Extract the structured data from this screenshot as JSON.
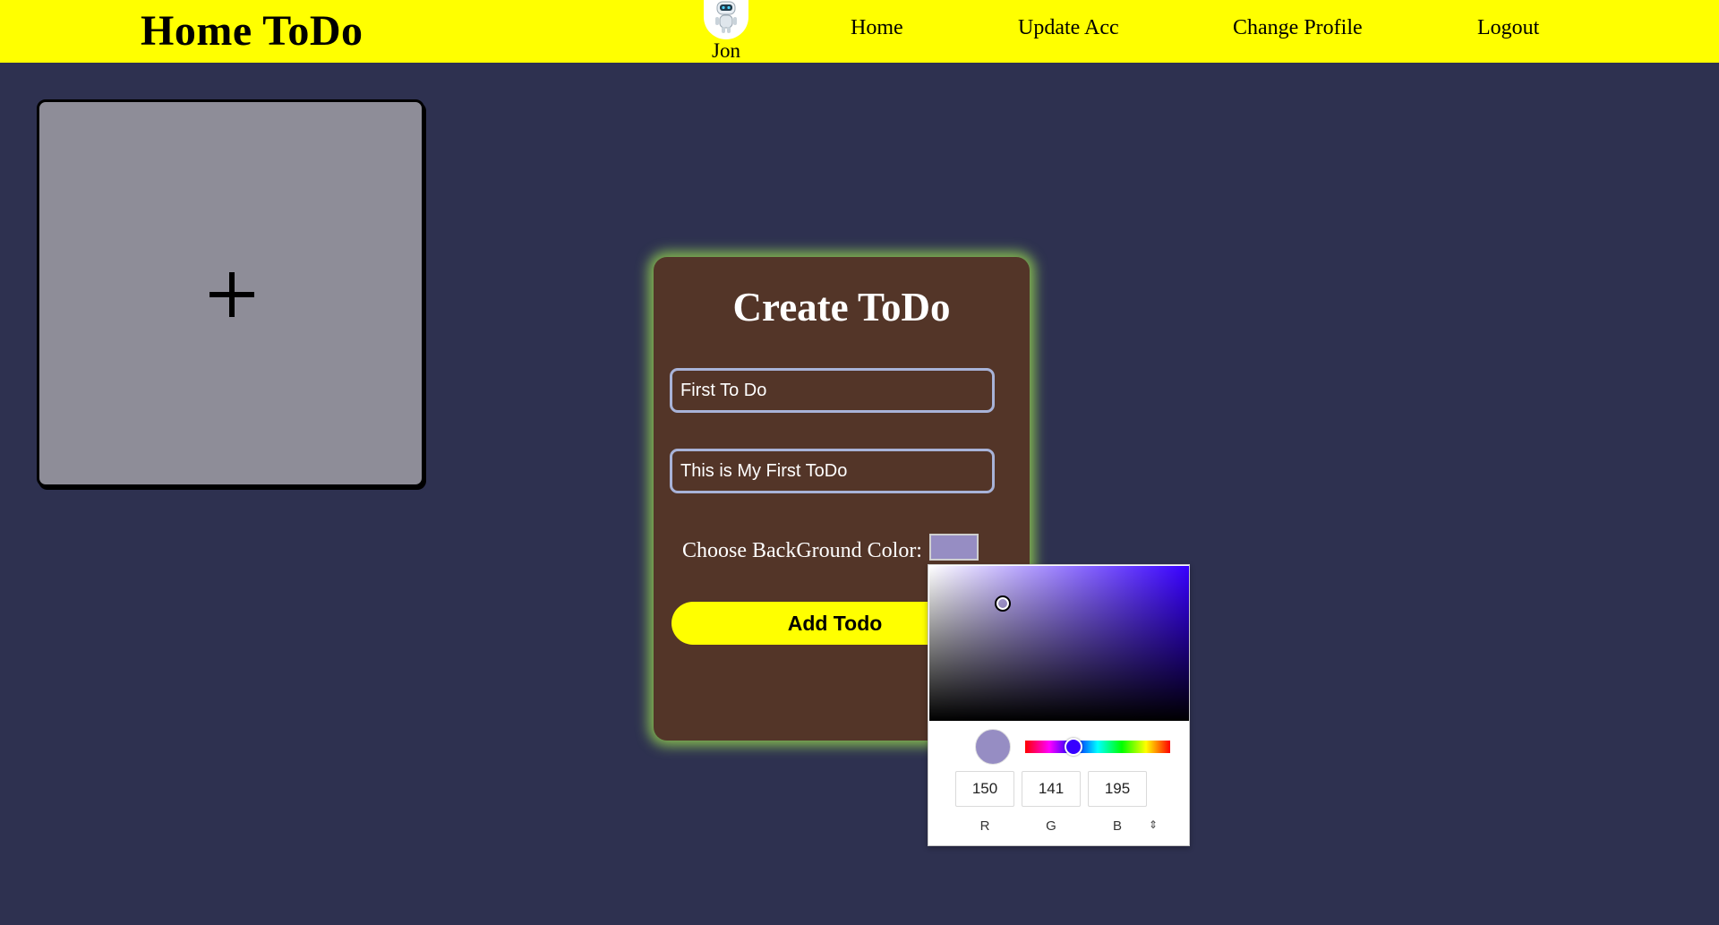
{
  "header": {
    "title": "Home ToDo",
    "user": {
      "name": "Jon",
      "avatar_icon": "robot-icon"
    },
    "nav": {
      "home": "Home",
      "update_acc": "Update Acc",
      "change_profile": "Change Profile",
      "logout": "Logout"
    }
  },
  "add_card": {
    "icon": "plus-icon"
  },
  "create_todo": {
    "title": "Create ToDo",
    "title_value": "First To Do",
    "description_value": "This is My First ToDo",
    "color_label": "Choose BackGround Color:",
    "color_value": "#968dc3",
    "submit_label": "Add Todo"
  },
  "color_picker": {
    "r": "150",
    "g": "141",
    "b": "195",
    "r_label": "R",
    "g_label": "G",
    "b_label": "B",
    "mode_toggle": "⇕"
  },
  "colors": {
    "background": "#2e3150",
    "navbar": "#ffff00",
    "card": "#533528",
    "add_card": "#8e8d98",
    "accent_glow": "#a0e650"
  }
}
